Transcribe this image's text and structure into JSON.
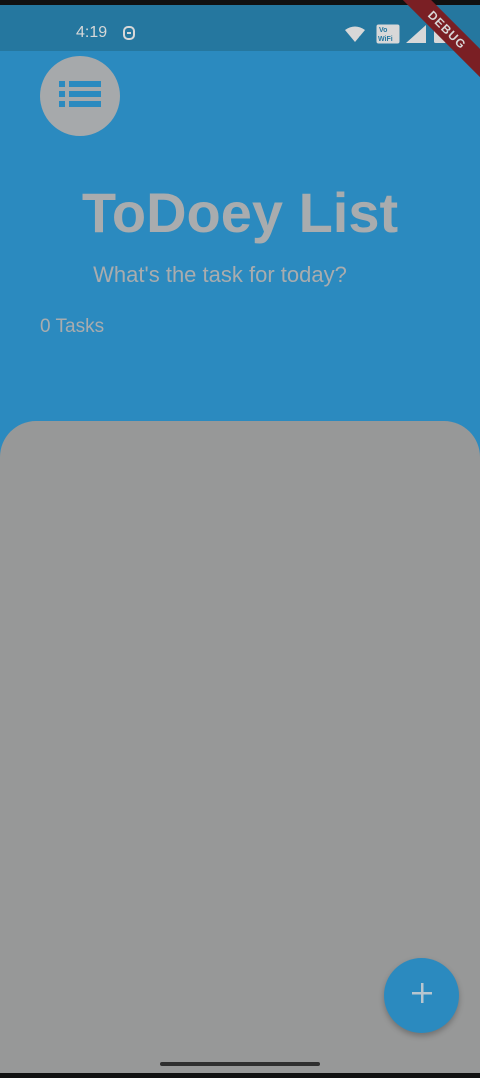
{
  "status_bar": {
    "time": "4:19"
  },
  "debug_banner": "DEBUG",
  "header": {
    "title": "ToDoey List",
    "subtitle": "What's the task for today?",
    "task_count": "0 Tasks"
  },
  "fab": {
    "label": "+"
  },
  "colors": {
    "header_bg": "#2b8abf",
    "status_bg": "#25779f",
    "sheet_bg": "#979898",
    "text_muted": "#a9acae",
    "accent": "#2b8abf"
  },
  "icons": {
    "menu": "list-icon",
    "fab": "add-icon",
    "wifi": "wifi-icon",
    "signal": "signal-icon",
    "battery": "battery-icon",
    "notification": "notification-icon",
    "volte": "vowifi-icon"
  }
}
